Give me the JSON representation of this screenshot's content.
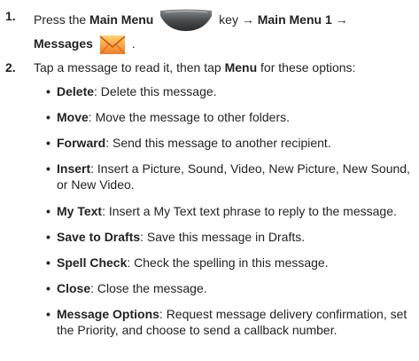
{
  "step1": {
    "number": "1.",
    "press": "Press the",
    "main_menu_key": "Main Menu",
    "key_word": "key",
    "arrow1": "→",
    "main_menu_1": "Main Menu 1",
    "arrow2": "→",
    "messages": "Messages",
    "period": ".",
    "icons": [
      "main-menu-key-icon",
      "messages-envelope-icon"
    ]
  },
  "step2": {
    "number": "2.",
    "text_a": "Tap a message to read it, then tap",
    "menu": "Menu",
    "text_b": "for these options:"
  },
  "options": [
    {
      "term": "Delete",
      "desc": ": Delete this message."
    },
    {
      "term": "Move",
      "desc": ": Move the message to other folders."
    },
    {
      "term": "Forward",
      "desc": ": Send this message to another recipient."
    },
    {
      "term": "Insert",
      "desc": ": Insert a Picture, Sound, Video, New Picture, New Sound, or New Video."
    },
    {
      "term": "My Text",
      "desc": ": Insert a My Text text phrase to reply to the message."
    },
    {
      "term": "Save to Drafts",
      "desc": ": Save this message in Drafts."
    },
    {
      "term": "Spell Check",
      "desc": ": Check the spelling in this message."
    },
    {
      "term": "Close",
      "desc": ": Close the message."
    },
    {
      "term": "Message Options",
      "desc": ": Request message delivery confirmation, set the Priority, and choose to send a callback number."
    }
  ],
  "bullet_char": "•"
}
